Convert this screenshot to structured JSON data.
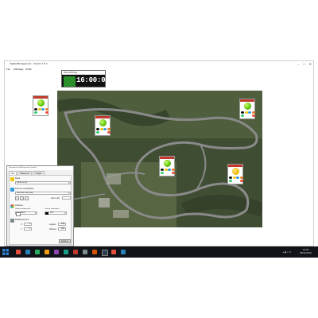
{
  "window": {
    "title": "VigilantManagement - Version 7.0.3",
    "controls": [
      "–",
      "□",
      "✕"
    ]
  },
  "menu": {
    "items": [
      "Fen",
      "Affichage",
      "Outils"
    ]
  },
  "clock": {
    "title": "Mode Affichage",
    "time": "16:00:04",
    "flag_color": "#2e9e2e"
  },
  "markers": [
    {
      "id": "m1",
      "label": "Marqueur"
    },
    {
      "id": "m2",
      "label": "Marqueur"
    },
    {
      "id": "m3",
      "label": "Marqueur"
    },
    {
      "id": "m4",
      "label": "Marqueur"
    },
    {
      "id": "m5",
      "label": "Marqueur"
    }
  ],
  "dialog": {
    "title": "Paramètres d'affichage de la fenêtre",
    "tabs": [
      "Vue",
      "Marqueurs",
      "Images"
    ],
    "section_mode": "Mode",
    "mode_value": "Mode de jour",
    "section_fond": "Fond de visualisation",
    "fond_value": "Microsoft carte (sat)",
    "zoom_label": "Zoom (%)",
    "section_couleurs": "Couleurs",
    "couleur_premier_plan_label": "Couleur premier plan",
    "couleur_arriere_plan_label": "Couleur arrière-plan",
    "couleur_premier_value": "Blanc",
    "couleur_arriere_value": "Noir",
    "section_position": "Positionnement",
    "x_label": "X",
    "y_label": "Y",
    "x_value": "0",
    "y_value": "0",
    "largeur_label": "Largeur",
    "hauteur_label": "Hauteur",
    "largeur_value": "100",
    "hauteur_value": "100",
    "apply_label": "Appliquer"
  },
  "taskbar": {
    "time": "16:00",
    "date": "08/11/2019",
    "colors": {
      "start": "#2d7dd2",
      "icons": [
        "#e74c3c",
        "#2980b9",
        "#27ae60",
        "#f39c12",
        "#8e44ad",
        "#16a085",
        "#c0392b",
        "#7f8c8d",
        "#d35400",
        "#2c3e50"
      ]
    }
  },
  "colors": {
    "terrain": "#4a5a3a",
    "track": "#8a8a8a",
    "marker_green": "#4fb800"
  }
}
